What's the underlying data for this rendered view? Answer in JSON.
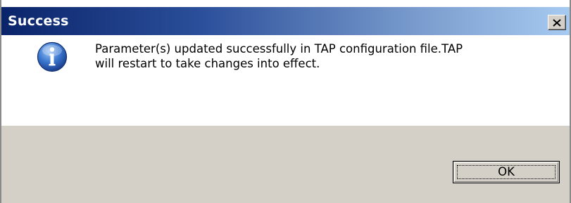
{
  "dialog": {
    "title": "Success",
    "message": "Parameter(s) updated successfully in TAP configuration file.TAP\nwill restart to take changes into effect.",
    "icon": "info-icon",
    "buttons": {
      "ok_label": "OK",
      "close_icon": "close-icon"
    }
  },
  "colors": {
    "title_gradient_start": "#0a246a",
    "title_gradient_end": "#a6caf0",
    "face": "#d4d0c8",
    "content_bg": "#ffffff"
  }
}
